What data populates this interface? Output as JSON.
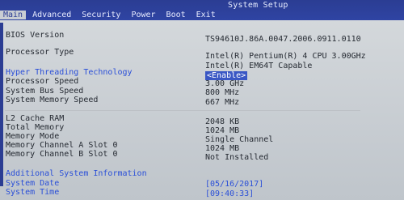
{
  "window": {
    "title": "System Setup"
  },
  "menu": {
    "items": [
      "Main",
      "Advanced",
      "Security",
      "Power",
      "Boot",
      "Exit"
    ]
  },
  "info": {
    "bios_version": {
      "label": "BIOS Version",
      "value": "TS94610J.86A.0047.2006.0911.0110"
    },
    "processor_type": {
      "label": "Processor Type",
      "value_line1": "Intel(R) Pentium(R) 4 CPU 3.00GHz",
      "value_line2": "Intel(R) EM64T Capable"
    },
    "hyper_threading": {
      "label": "Hyper Threading Technology",
      "value": "<Enable>"
    },
    "processor_speed": {
      "label": "Processor Speed",
      "value": "3.00 GHz"
    },
    "system_bus_speed": {
      "label": "System Bus Speed",
      "value": "800 MHz"
    },
    "system_memory_speed": {
      "label": "System Memory Speed",
      "value": "667 MHz"
    },
    "l2_cache": {
      "label": "L2 Cache RAM",
      "value": "2048 KB"
    },
    "total_memory": {
      "label": "Total Memory",
      "value": "1024 MB"
    },
    "memory_mode": {
      "label": "Memory Mode",
      "value": "Single Channel"
    },
    "mem_a_slot0": {
      "label": "Memory Channel A Slot 0",
      "value": "1024 MB"
    },
    "mem_b_slot0": {
      "label": "Memory Channel B Slot 0",
      "value": "Not Installed"
    },
    "additional_info": {
      "label": "Additional System Information"
    },
    "system_date": {
      "label": "System Date",
      "value": "[05/16/2017]"
    },
    "system_time": {
      "label": "System Time",
      "value": "[09:40:33]"
    }
  },
  "colors": {
    "top_bar": "#2b3d93",
    "background": "#c9ced3",
    "accent_text": "#2a4fd8"
  }
}
